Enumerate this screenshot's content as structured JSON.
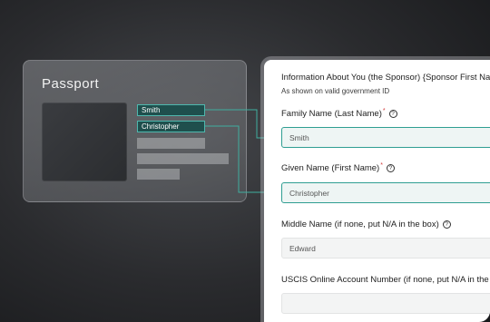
{
  "passport": {
    "title": "Passport",
    "last_name_chip": "Smith",
    "first_name_chip": "Christopher"
  },
  "form": {
    "section_title": "Information About You (the Sponsor) {Sponsor First Name}",
    "section_subtitle": "As shown on valid government ID",
    "fields": [
      {
        "label": "Family Name (Last Name)",
        "required": "*",
        "value": "Smith"
      },
      {
        "label": "Given Name (First Name)",
        "required": "*",
        "value": "Christopher"
      },
      {
        "label": "Middle Name (if none, put N/A in the box)",
        "value": "Edward"
      },
      {
        "label": "USCIS Online Account Number (if none, put N/A in the box)",
        "value": ""
      }
    ],
    "help_glyph": "?"
  },
  "colors": {
    "accent": "#2f9e92",
    "chip_bg": "#1f4f4d",
    "required": "#d23b3b"
  }
}
